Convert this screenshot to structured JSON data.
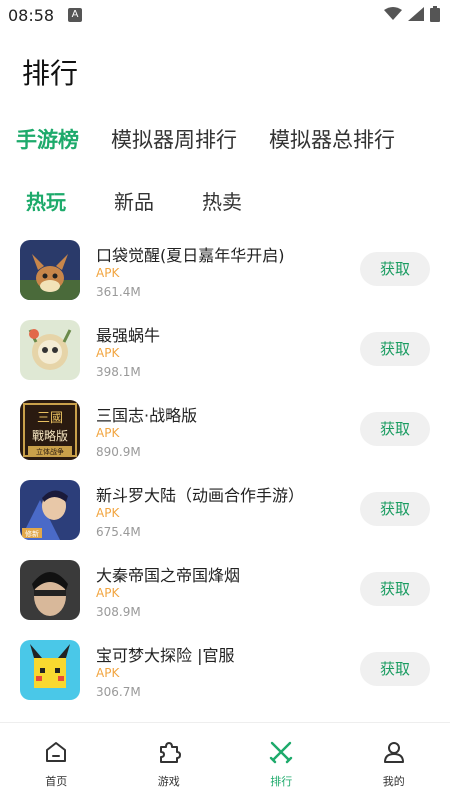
{
  "status": {
    "time": "08:58",
    "indicator": "A"
  },
  "page_title": "排行",
  "top_tabs": [
    {
      "label": "手游榜",
      "active": true
    },
    {
      "label": "模拟器周排行",
      "active": false
    },
    {
      "label": "模拟器总排行",
      "active": false
    }
  ],
  "sub_tabs": [
    {
      "label": "热玩",
      "active": true
    },
    {
      "label": "新品",
      "active": false
    },
    {
      "label": "热卖",
      "active": false
    }
  ],
  "apps": [
    {
      "name": "口袋觉醒(夏日嘉年华开启)",
      "type": "APK",
      "size": "361.4M",
      "button": "获取"
    },
    {
      "name": "最强蜗牛",
      "type": "APK",
      "size": "398.1M",
      "button": "获取"
    },
    {
      "name": "三国志·战略版",
      "type": "APK",
      "size": "890.9M",
      "button": "获取"
    },
    {
      "name": "新斗罗大陆（动画合作手游）",
      "type": "APK",
      "size": "675.4M",
      "button": "获取"
    },
    {
      "name": "大秦帝国之帝国烽烟",
      "type": "APK",
      "size": "308.9M",
      "button": "获取"
    },
    {
      "name": "宝可梦大探险 |官服",
      "type": "APK",
      "size": "306.7M",
      "button": "获取"
    }
  ],
  "app_icon_art": {
    "icon1_text": "",
    "icon3_text_top": "三國",
    "icon3_text_mid": "戰略版",
    "icon3_text_bottom": "立体战争",
    "icon4_badge": "修新"
  },
  "bottom_tabs": [
    {
      "label": "首页",
      "icon": "home-icon"
    },
    {
      "label": "游戏",
      "icon": "puzzle-icon"
    },
    {
      "label": "排行",
      "icon": "crossed-swords-icon",
      "active": true
    },
    {
      "label": "我的",
      "icon": "person-icon"
    }
  ],
  "colors": {
    "accent": "#1daa6b",
    "apk": "#f2a540"
  }
}
